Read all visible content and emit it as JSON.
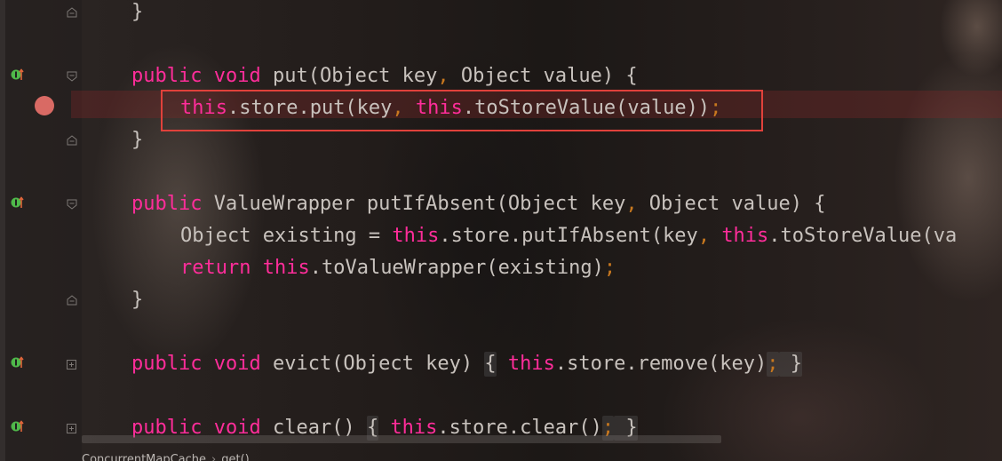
{
  "editor": {
    "lines": [
      {
        "id": "l1",
        "tokens": {
          "a": "}"
        }
      },
      {
        "id": "l2",
        "tokens": {
          "kw1": "public",
          "kw2": "void",
          "rest": " put(Object key",
          "comma": ",",
          "rest2": " Object value) {"
        }
      },
      {
        "id": "l3",
        "tokens": {
          "this1": "this",
          "a": ".store.put(key",
          "comma": ",",
          "sp": " ",
          "this2": "this",
          "b": ".toStoreValue(value))",
          "semi": ";"
        }
      },
      {
        "id": "l4",
        "tokens": {
          "a": "}"
        }
      },
      {
        "id": "l5",
        "tokens": {
          "kw1": "public",
          "rest": " ValueWrapper putIfAbsent(Object key",
          "comma": ",",
          "rest2": " Object value) {"
        }
      },
      {
        "id": "l6",
        "tokens": {
          "a": "Object existing = ",
          "this1": "this",
          "b": ".store.putIfAbsent(key",
          "comma": ",",
          "sp": " ",
          "this2": "this",
          "c": ".toStoreValue(va"
        }
      },
      {
        "id": "l7",
        "tokens": {
          "kw": "return",
          "sp": " ",
          "this1": "this",
          "a": ".toValueWrapper(existing)",
          "semi": ";"
        }
      },
      {
        "id": "l8",
        "tokens": {
          "a": "}"
        }
      },
      {
        "id": "l9",
        "tokens": {
          "kw1": "public",
          "kw2": "void",
          "a": " evict(Object key) ",
          "ob": "{",
          "sp": " ",
          "this1": "this",
          "b": ".store.remove(key)",
          "semi": ";",
          "cb": " }"
        }
      },
      {
        "id": "l10",
        "tokens": {
          "kw1": "public",
          "kw2": "void",
          "a": " clear() ",
          "ob": "{",
          "sp": " ",
          "this1": "this",
          "b": ".store.clear()",
          "semi": ";",
          "cb": " }"
        }
      }
    ]
  },
  "breadcrumb": {
    "items": [
      "ConcurrentMapCache",
      "get()"
    ],
    "separator": "›"
  },
  "colors": {
    "keyword": "#ff2d9a",
    "text": "#c8c2bd",
    "punctuation": "#c8781f",
    "breakpoint": "#d96a64",
    "highlight_border": "#e0413b",
    "impl_icon": "#4fb84a",
    "override_arrow": "#e0663a"
  },
  "icons": {
    "breakpoint": "breakpoint-icon",
    "implementing": "implementing-method-icon",
    "fold": "fold-icon"
  }
}
